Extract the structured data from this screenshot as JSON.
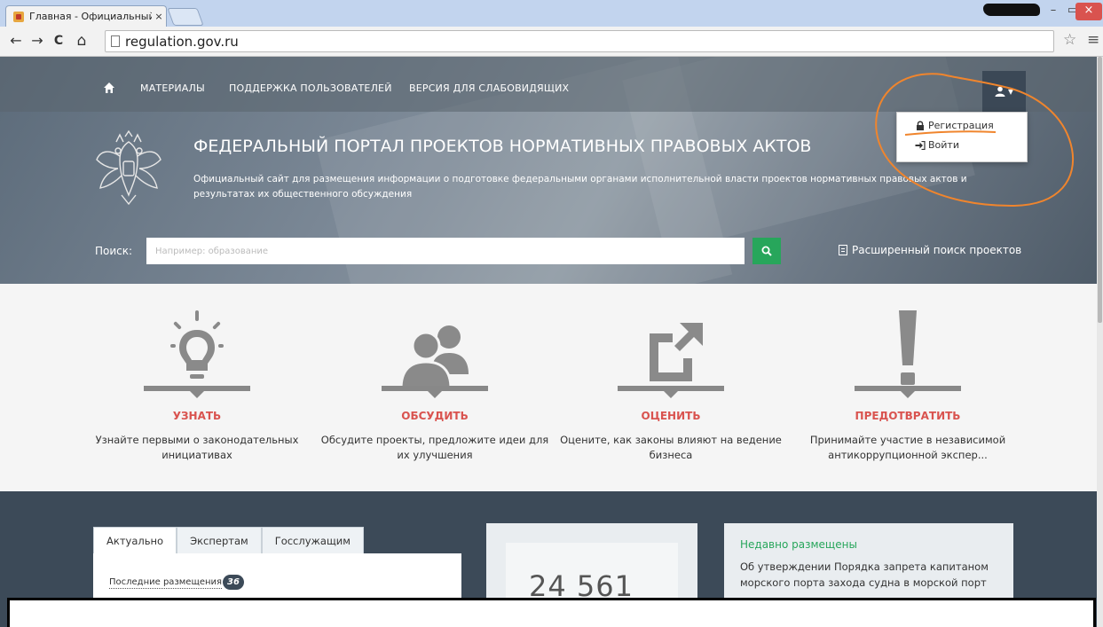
{
  "browser": {
    "tab_title": "Главная - Официальный",
    "tab_close": "×",
    "url": "regulation.gov.ru",
    "window_min": "–",
    "window_max": "▭",
    "window_close": "×",
    "back": "←",
    "forward": "→",
    "reload": "C",
    "home": "⌂",
    "star": "☆",
    "menu": "≡"
  },
  "nav": {
    "links": [
      "МАТЕРИАЛЫ",
      "ПОДДЕРЖКА ПОЛЬЗОВАТЕЛЕЙ",
      "ВЕРСИЯ ДЛЯ СЛАБОВИДЯЩИХ"
    ],
    "user_caret": "▾"
  },
  "hero": {
    "title": "ФЕДЕРАЛЬНЫЙ ПОРТАЛ ПРОЕКТОВ НОРМАТИВНЫХ ПРАВОВЫХ АКТОВ",
    "description": "Официальный сайт для размещения информации о подготовке федеральными органами исполнительной власти проектов нормативных правовых актов и результатах их общественного обсуждения"
  },
  "search": {
    "label": "Поиск:",
    "placeholder": "Например: образование",
    "advanced": "Расширенный поиск проектов"
  },
  "dropdown": {
    "register": "Регистрация",
    "login": "Войти"
  },
  "features": [
    {
      "title": "УЗНАТЬ",
      "desc": "Узнайте первыми о законодательных инициативах"
    },
    {
      "title": "ОБСУДИТЬ",
      "desc": "Обсудите проекты, предложите идеи для их улучшения"
    },
    {
      "title": "ОЦЕНИТЬ",
      "desc": "Оцените, как законы влияют на ведение бизнеса"
    },
    {
      "title": "ПРЕДОТВРАТИТЬ",
      "desc": "Принимайте участие в независимой антикоррупционной экспер..."
    }
  ],
  "panel": {
    "tabs": [
      "Актуально",
      "Экспертам",
      "Госслужащим"
    ],
    "recent_label": "Последние размещения",
    "recent_count": "36"
  },
  "counter": {
    "value": "24 561"
  },
  "news": {
    "heading": "Недавно размещены",
    "text": "Об утверждении Порядка запрета капитаном морского порта захода судна в морской порт"
  },
  "colors": {
    "accent_green": "#27a65b",
    "accent_red": "#d9534f",
    "dark_bg": "#3c4a58",
    "annotation_orange": "#f0852d"
  }
}
